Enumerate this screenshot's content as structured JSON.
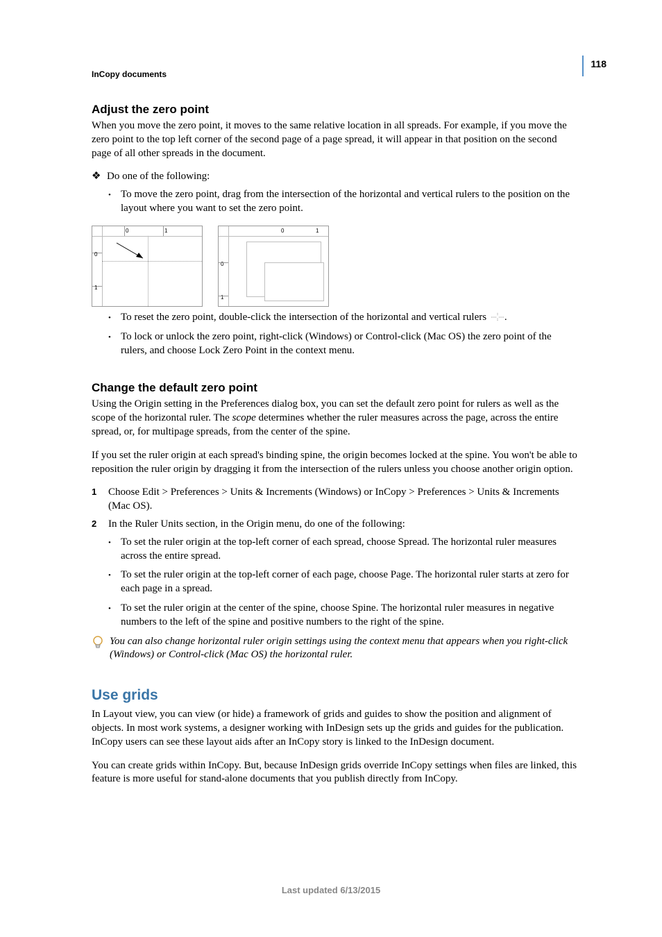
{
  "meta": {
    "running_head": "InCopy documents",
    "page_number": "118",
    "footer": "Last updated 6/13/2015"
  },
  "sections": {
    "adjust_zero": {
      "heading": "Adjust the zero point",
      "intro": "When you move the zero point, it moves to the same relative location in all spreads. For example, if you move the zero point to the top left corner of the second page of a page spread, it will appear in that position on the second page of all other spreads in the document.",
      "do_one": "Do one of the following:",
      "bullet_move": "To move the zero point, drag from the intersection of the horizontal and vertical rulers to the position on the layout where you want to set the zero point.",
      "bullet_reset_pre": "To reset the zero point, double-click the intersection of the horizontal and vertical rulers",
      "bullet_reset_post": ".",
      "bullet_lock": "To lock or unlock the zero point, right-click (Windows) or Control-click (Mac OS) the zero point of the rulers, and choose Lock Zero Point in the context menu."
    },
    "change_default": {
      "heading": "Change the default zero point",
      "para_1_a": "Using the Origin setting in the Preferences dialog box, you can set the default zero point for rulers as well as the scope of the horizontal ruler. The ",
      "para_1_em": "scope",
      "para_1_b": " determines whether the ruler measures across the page, across the entire spread, or, for multipage spreads, from the center of the spine.",
      "para_2": "If you set the ruler origin at each spread's binding spine, the origin becomes locked at the spine. You won't be able to reposition the ruler origin by dragging it from the intersection of the rulers unless you choose another origin option.",
      "step_1": "Choose Edit > Preferences > Units & Increments (Windows) or InCopy > Preferences > Units & Increments (Mac OS).",
      "step_2": "In the Ruler Units section, in the Origin menu, do one of the following:",
      "sub_a": "To set the ruler origin at the top-left corner of each spread, choose Spread. The horizontal ruler measures across the entire spread.",
      "sub_b": "To set the ruler origin at the top-left corner of each page, choose Page. The horizontal ruler starts at zero for each page in a spread.",
      "sub_c": "To set the ruler origin at the center of the spine, choose Spine. The horizontal ruler measures in negative numbers to the left of the spine and positive numbers to the right of the spine.",
      "tip": "You can also change horizontal ruler origin settings using the context menu that appears when you right-click (Windows) or Control-click (Mac OS) the horizontal ruler."
    },
    "use_grids": {
      "heading": "Use grids",
      "para_1": "In Layout view, you can view (or hide) a framework of grids and guides to show the position and alignment of objects. In most work systems, a designer working with InDesign sets up the grids and guides for the publication. InCopy users can see these layout aids after an InCopy story is linked to the InDesign document.",
      "para_2": "You can create grids within InCopy. But, because InDesign grids override InCopy settings when files are linked, this feature is more useful for stand-alone documents that you publish directly from InCopy."
    }
  },
  "fig_labels": {
    "zero": "0",
    "one": "1"
  }
}
